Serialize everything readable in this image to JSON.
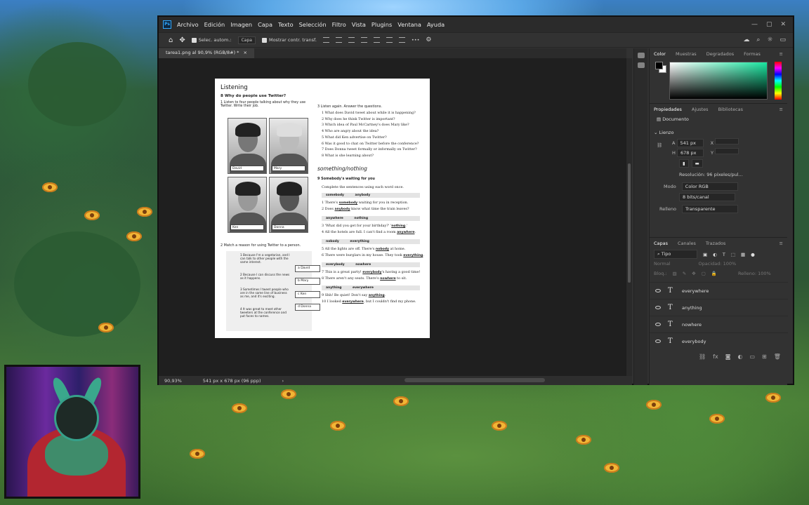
{
  "photoshop": {
    "menu": [
      "Archivo",
      "Edición",
      "Imagen",
      "Capa",
      "Texto",
      "Selección",
      "Filtro",
      "Vista",
      "Plugins",
      "Ventana",
      "Ayuda"
    ],
    "window_controls": [
      "—",
      "▢",
      "✕"
    ],
    "options_bar": {
      "auto_select_label": "Selec. autom.:",
      "auto_select_target": "Capa",
      "show_transform_label": "Mostrar contr. transf.",
      "more": "•••"
    },
    "doc_tab": {
      "title": "tarea1.png al 90,9% (RGB/8#) *",
      "close": "×"
    },
    "status": {
      "zoom": "90,93%",
      "doc_info": "541 px x 678 px (96 ppp)",
      "arrow": "›"
    },
    "panels": {
      "color_tabs": [
        "Color",
        "Muestras",
        "Degradados",
        "Formas"
      ],
      "color": {
        "foreground": "#000000",
        "background": "#ffffff",
        "field_hue": "#19e6a0"
      },
      "props_tabs": [
        "Propiedades",
        "Ajustes",
        "Bibliotecas"
      ],
      "props": {
        "doc_label": "Documento",
        "canvas_section": "Lienzo",
        "w_label": "A",
        "w_value": "541 px",
        "x_label": "X",
        "h_label": "H",
        "h_value": "678 px",
        "y_label": "Y",
        "resolution": "Resolución: 96 píxeles/pul...",
        "mode_label": "Modo",
        "mode_value": "Color RGB",
        "depth_value": "8 bits/canal",
        "fill_label": "Relleno",
        "fill_value": "Transparente"
      },
      "layers_tabs": [
        "Capas",
        "Canales",
        "Trazados"
      ],
      "layers": {
        "kind_filter": "Tipo",
        "blend_mode": "Normal",
        "opacity_label": "Opacidad:",
        "opacity_value": "100%",
        "lock_label": "Bloq.:",
        "fill_label": "Relleno:",
        "fill_value": "100%",
        "items": [
          "everywhere",
          "anything",
          "nowhere",
          "everybody"
        ]
      }
    }
  },
  "document": {
    "heading": "Listening",
    "section8": "8  Why do people use Twitter?",
    "task1": "1   Listen to four people talking about why they use Twitter. Write their job.",
    "photos": [
      "David",
      "Mary",
      "Ken",
      "Donna"
    ],
    "task2": "2   Match a reason for using Twitter to a person.",
    "reasons": [
      "1  Because I'm a vegetarian, and I can talk to other people with the same interest.",
      "2  Because I can discuss the news as it happens.",
      "3  Sometimes I tweet people who are in the same line of business as me, and it's exciting.",
      "4  It was great to meet other tweeters at the conference and put faces to names."
    ],
    "options": [
      "a  David",
      "b  Mary",
      "c  Ken",
      "d  Donna"
    ],
    "task3": "3   Listen again. Answer the questions.",
    "questions": [
      "1  What does David tweet about while it is happening?",
      "2  Why does he think Twitter is important?",
      "3  Which idea of Paul McCartney's does Mary like?",
      "4  Who are angry about the idea?",
      "5  What did Ken advertise on Twitter?",
      "6  Was it good to chat on Twitter before the conference?",
      "7  Does Donna tweet formally or informally on Twitter?",
      "8  What is she learning about?"
    ],
    "sn_title": "something/nothing",
    "section9": "9  Somebody's waiting for you",
    "instr": "Complete the sentences using each word once.",
    "groups": [
      {
        "words": "somebody  anybody",
        "lines": [
          {
            "pre": "1  There's ",
            "ans": "somebody",
            "post": " waiting for you in reception."
          },
          {
            "pre": "2  Does ",
            "ans": "anybody",
            "post": " know what time the train leaves?"
          }
        ]
      },
      {
        "words": "anywhere  nothing",
        "lines": [
          {
            "pre": "3  'What did you get for your birthday?' '",
            "ans": "nothing",
            "post": ".'"
          },
          {
            "pre": "4  All the hotels are full. I can't find a room ",
            "ans": "anywhere",
            "post": "."
          }
        ]
      },
      {
        "words": "nobody  everything",
        "lines": [
          {
            "pre": "5  All the lights are off. There's ",
            "ans": "nobody",
            "post": " at home."
          },
          {
            "pre": "6  There were burglars in my house. They took ",
            "ans": "everything",
            "post": "."
          }
        ]
      },
      {
        "words": "everybody  nowhere",
        "lines": [
          {
            "pre": "7  This is a great party! ",
            "ans": "everybody",
            "post": "'s having a good time!"
          },
          {
            "pre": "8  There aren't any seats. There's ",
            "ans": "nowhere",
            "post": " to sit."
          }
        ]
      },
      {
        "words": "anything  everywhere",
        "lines": [
          {
            "pre": "9  Shh! Be quiet! Don't say ",
            "ans": "anything",
            "post": "."
          },
          {
            "pre": "10  I looked ",
            "ans": "everywhere",
            "post": ", but I couldn't find my phone."
          }
        ]
      }
    ]
  }
}
